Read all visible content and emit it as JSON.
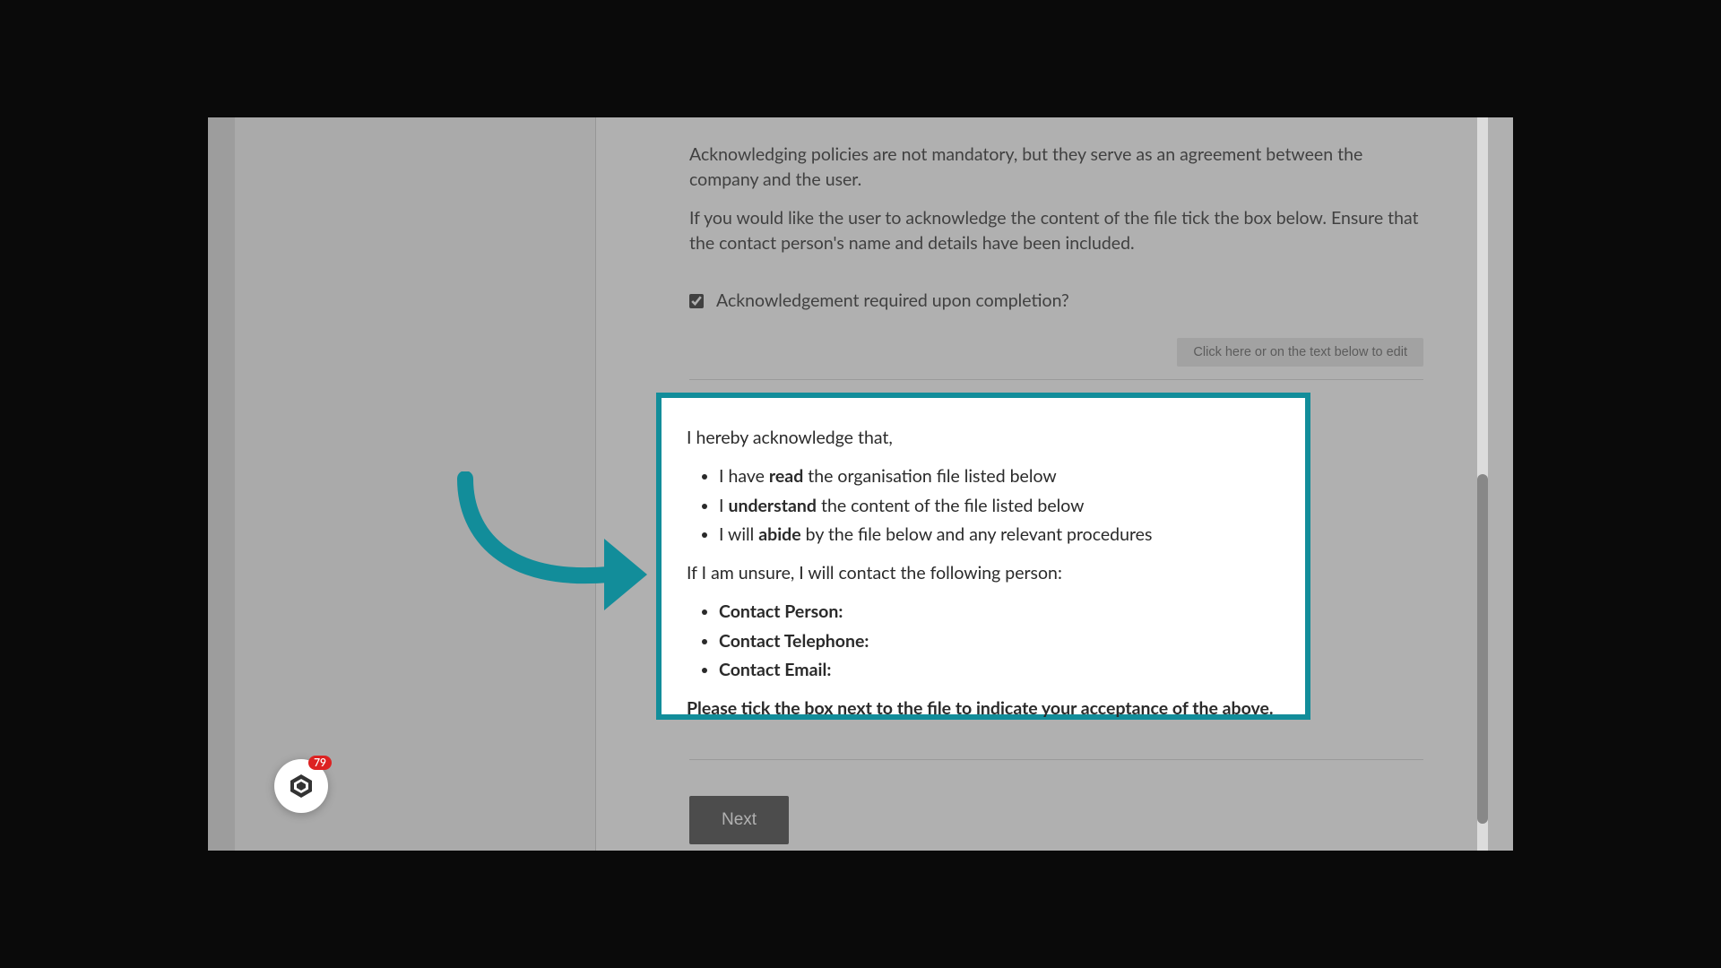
{
  "colors": {
    "accent": "#128d9a",
    "badge": "#d22"
  },
  "intro": {
    "para1": "Acknowledging policies are not mandatory, but they serve as an agreement between the company and the user.",
    "para2": "If you would like the user to acknowledge the content of the file tick the box below. Ensure that the contact person's name and details have been included."
  },
  "checkbox": {
    "label": "Acknowledgement required upon completion?",
    "checked": true
  },
  "edit_hint": "Click here or on the text below to edit",
  "acknowledgement": {
    "opening": "I hereby acknowledge that,",
    "items": [
      {
        "pre": "I have ",
        "bold": "read",
        "post": " the organisation file listed below"
      },
      {
        "pre": "I ",
        "bold": "understand",
        "post": " the content of the file listed below"
      },
      {
        "pre": "I will ",
        "bold": "abide",
        "post": " by the file below and any relevant procedures"
      }
    ],
    "unsure": "If I am unsure, I will contact the following person:",
    "contacts": [
      "Contact Person:",
      "Contact Telephone:",
      "Contact Email:"
    ],
    "closing": "Please tick the box next to the file to indicate your acceptance of the above."
  },
  "next_label": "Next",
  "widget": {
    "badge_count": "79",
    "icon_name": "logo-icon"
  }
}
